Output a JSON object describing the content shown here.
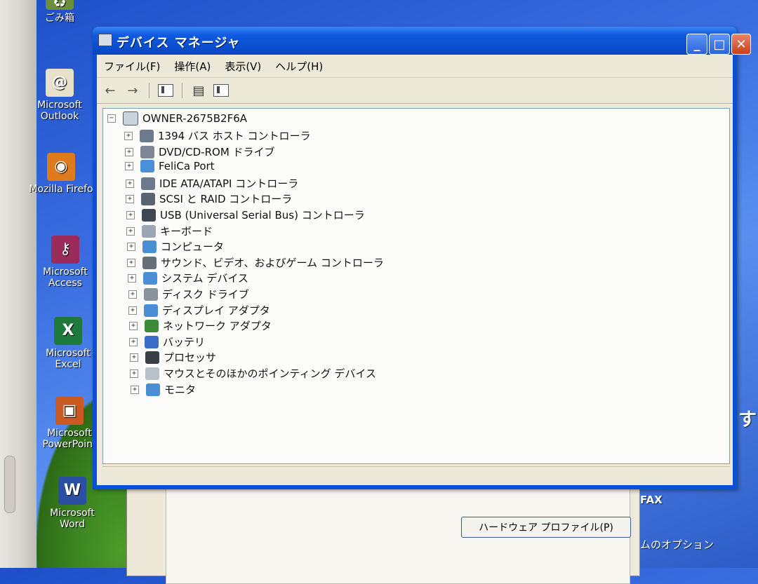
{
  "desktop": {
    "icons": [
      {
        "label": "ごみ箱",
        "name": "recycle-bin"
      },
      {
        "label": "Microsoft\nOutlook",
        "name": "outlook"
      },
      {
        "label": "Mozilla Firefo",
        "name": "firefox"
      },
      {
        "label": "Microsoft\nAccess",
        "name": "access"
      },
      {
        "label": "Microsoft\nExcel",
        "name": "excel"
      },
      {
        "label": "Microsoft\nPowerPoint",
        "name": "powerpoint"
      },
      {
        "label": "Microsoft\nWord",
        "name": "word"
      }
    ],
    "right_fax": "FAX",
    "right_options": "ムのオプション",
    "right_su": "す"
  },
  "background_dialog": {
    "hardware_profile_button": "ハードウェア プロファイル(P)"
  },
  "window": {
    "title": "デバイス マネージャ",
    "menu": [
      "ファイル(F)",
      "操作(A)",
      "表示(V)",
      "ヘルプ(H)"
    ],
    "tree": {
      "root": "OWNER-2675B2F6A",
      "items": [
        {
          "label": "1394 バス ホスト コントローラ",
          "icon": "controller-icon",
          "color": "#6b7a8c"
        },
        {
          "label": "DVD/CD-ROM ドライブ",
          "icon": "dvd-drive-icon",
          "color": "#7d8694"
        },
        {
          "label": "FeliCa Port",
          "icon": "felica-icon",
          "color": "#4a90d9"
        },
        {
          "label": "IDE ATA/ATAPI コントローラ",
          "icon": "ide-controller-icon",
          "color": "#6b7a8c"
        },
        {
          "label": "SCSI と RAID コントローラ",
          "icon": "scsi-controller-icon",
          "color": "#5a6470"
        },
        {
          "label": "USB (Universal Serial Bus) コントローラ",
          "icon": "usb-icon",
          "color": "#3e4855"
        },
        {
          "label": "キーボード",
          "icon": "keyboard-icon",
          "color": "#9aa6b5"
        },
        {
          "label": "コンピュータ",
          "icon": "computer-icon",
          "color": "#4a8fd6"
        },
        {
          "label": "サウンド、ビデオ、およびゲーム コントローラ",
          "icon": "sound-icon",
          "color": "#666e78"
        },
        {
          "label": "システム デバイス",
          "icon": "system-device-icon",
          "color": "#4a8fd6"
        },
        {
          "label": "ディスク ドライブ",
          "icon": "disk-drive-icon",
          "color": "#8a929c"
        },
        {
          "label": "ディスプレイ アダプタ",
          "icon": "display-adapter-icon",
          "color": "#4a8fd6"
        },
        {
          "label": "ネットワーク アダプタ",
          "icon": "network-adapter-icon",
          "color": "#3a8a3a"
        },
        {
          "label": "バッテリ",
          "icon": "battery-icon",
          "color": "#3c6cc9"
        },
        {
          "label": "プロセッサ",
          "icon": "processor-icon",
          "color": "#3a3f45"
        },
        {
          "label": "マウスとそのほかのポインティング デバイス",
          "icon": "mouse-icon",
          "color": "#b8c0ca"
        },
        {
          "label": "モニタ",
          "icon": "monitor-icon",
          "color": "#4a8fd6"
        }
      ]
    }
  }
}
